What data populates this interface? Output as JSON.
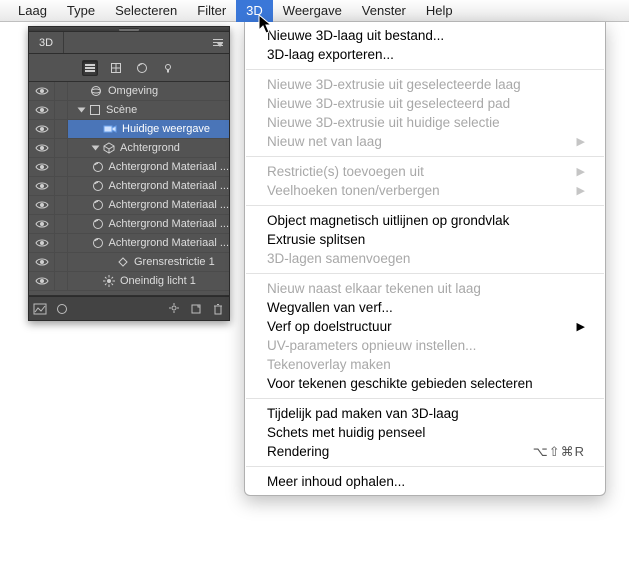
{
  "menubar": {
    "items": [
      "Laag",
      "Type",
      "Selecteren",
      "Filter",
      "3D",
      "Weergave",
      "Venster",
      "Help"
    ],
    "active_index": 4
  },
  "dropdown": {
    "groups": [
      [
        {
          "label": "Nieuwe 3D-laag uit bestand...",
          "enabled": true
        },
        {
          "label": "3D-laag exporteren...",
          "enabled": true
        }
      ],
      [
        {
          "label": "Nieuwe 3D-extrusie uit geselecteerde laag",
          "enabled": false
        },
        {
          "label": "Nieuwe 3D-extrusie uit geselecteerd pad",
          "enabled": false
        },
        {
          "label": "Nieuwe 3D-extrusie uit huidige selectie",
          "enabled": false
        },
        {
          "label": "Nieuw net van laag",
          "enabled": false,
          "submenu": true
        }
      ],
      [
        {
          "label": "Restrictie(s) toevoegen uit",
          "enabled": false,
          "submenu": true
        },
        {
          "label": "Veelhoeken tonen/verbergen",
          "enabled": false,
          "submenu": true
        }
      ],
      [
        {
          "label": "Object magnetisch uitlijnen op grondvlak",
          "enabled": true
        },
        {
          "label": "Extrusie splitsen",
          "enabled": true
        },
        {
          "label": "3D-lagen samenvoegen",
          "enabled": false
        }
      ],
      [
        {
          "label": "Nieuw naast elkaar tekenen uit laag",
          "enabled": false
        },
        {
          "label": "Wegvallen van verf...",
          "enabled": true
        },
        {
          "label": "Verf op doelstructuur",
          "enabled": true,
          "submenu": true
        },
        {
          "label": "UV-parameters opnieuw instellen...",
          "enabled": false
        },
        {
          "label": "Tekenoverlay maken",
          "enabled": false
        },
        {
          "label": "Voor tekenen geschikte gebieden selecteren",
          "enabled": true
        }
      ],
      [
        {
          "label": "Tijdelijk pad maken van 3D-laag",
          "enabled": true
        },
        {
          "label": "Schets met huidig penseel",
          "enabled": true
        },
        {
          "label": "Rendering",
          "enabled": true,
          "shortcut": "⌥⇧⌘R"
        }
      ],
      [
        {
          "label": "Meer inhoud ophalen...",
          "enabled": true
        }
      ]
    ]
  },
  "panel": {
    "tab_label": "3D",
    "toolbar_icons": [
      "filter-icon",
      "mesh-icon",
      "material-icon",
      "light-icon"
    ],
    "tree": [
      {
        "indent": 0,
        "icon": "environment-icon",
        "label": "Omgeving",
        "vis": true
      },
      {
        "indent": 0,
        "icon": "scene-icon",
        "label": "Scène",
        "vis": true,
        "twisty": "open"
      },
      {
        "indent": 1,
        "icon": "camera-icon",
        "label": "Huidige weergave",
        "vis": true,
        "selected": true
      },
      {
        "indent": 1,
        "icon": "mesh-node-icon",
        "label": "Achtergrond",
        "vis": true,
        "twisty": "open"
      },
      {
        "indent": 2,
        "icon": "material-node-icon",
        "label": "Achtergrond Materiaal ...",
        "vis": true
      },
      {
        "indent": 2,
        "icon": "material-node-icon",
        "label": "Achtergrond Materiaal ...",
        "vis": true
      },
      {
        "indent": 2,
        "icon": "material-node-icon",
        "label": "Achtergrond Materiaal ...",
        "vis": true
      },
      {
        "indent": 2,
        "icon": "material-node-icon",
        "label": "Achtergrond Materiaal ...",
        "vis": true
      },
      {
        "indent": 2,
        "icon": "material-node-icon",
        "label": "Achtergrond Materiaal ...",
        "vis": true
      },
      {
        "indent": 2,
        "icon": "constraint-icon",
        "label": "Grensrestrictie 1",
        "vis": true
      },
      {
        "indent": 1,
        "icon": "light-node-icon",
        "label": "Oneindig licht 1",
        "vis": true
      }
    ],
    "footer_icons": [
      "picture-icon",
      "sphere-icon",
      "new-icon",
      "trash-icon"
    ]
  }
}
